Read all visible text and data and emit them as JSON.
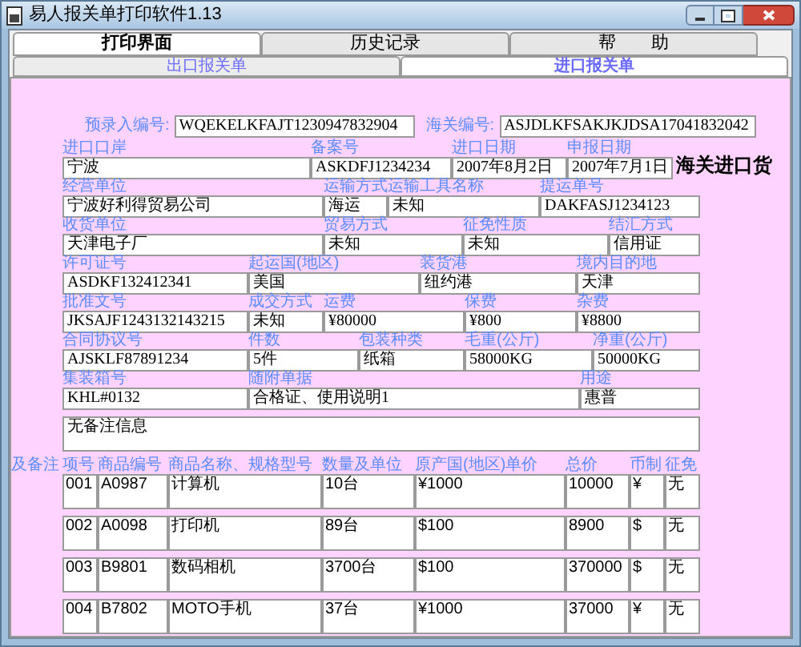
{
  "window": {
    "title": "易人报关单打印软件1.13"
  },
  "tabs": [
    {
      "label": "打印界面",
      "selected": true
    },
    {
      "label": "历史记录",
      "selected": false
    },
    {
      "label": "帮　　助",
      "selected": false
    }
  ],
  "subtabs": [
    {
      "label": "出口报关单",
      "selected": false
    },
    {
      "label": "进口报关单",
      "selected": true
    }
  ],
  "form": {
    "preentry_no": {
      "label": "预录入编号:",
      "value": "WQEKELKFAJT1230947832904"
    },
    "customs_no": {
      "label": "海关编号:",
      "value": "ASJDLKFSAKJKJDSA17041832042"
    },
    "title": "海关进口货",
    "field_lines": [
      [
        {
          "label": "进口口岸",
          "value": "宁波"
        },
        {
          "label": "备案号",
          "value": "ASKDFJ1234234"
        },
        {
          "label": "进口日期",
          "value": "2007年8月2日"
        },
        {
          "label": "申报日期",
          "value": "2007年7月1日"
        }
      ],
      [
        {
          "label": "经营单位",
          "value": "宁波好利得贸易公司"
        },
        {
          "label": "运输方式",
          "value": "海运"
        },
        {
          "label": "运输工具名称",
          "value": "未知"
        },
        {
          "label": "提运单号",
          "value": "DAKFASJ1234123"
        }
      ],
      [
        {
          "label": "收货单位",
          "value": "天津电子厂"
        },
        {
          "label": "贸易方式",
          "value": "未知"
        },
        {
          "label": "征免性质",
          "value": "未知"
        },
        {
          "label": "结汇方式",
          "value": "信用证"
        }
      ],
      [
        {
          "label": "许可证号",
          "value": "ASDKF132412341"
        },
        {
          "label": "起运国(地区)",
          "value": "美国"
        },
        {
          "label": "装货港",
          "value": "纽约港"
        },
        {
          "label": "境内目的地",
          "value": "天津"
        }
      ],
      [
        {
          "label": "批准文号",
          "value": "JKSAJF1243132143215"
        },
        {
          "label": "成交方式",
          "value": "未知"
        },
        {
          "label": "运费",
          "value": "¥80000"
        },
        {
          "label": "保费",
          "value": "¥800"
        },
        {
          "label": "杂费",
          "value": "¥8800"
        }
      ],
      [
        {
          "label": "合同协议号",
          "value": "AJSKLF87891234"
        },
        {
          "label": "件数",
          "value": "5件"
        },
        {
          "label": "包装种类",
          "value": "纸箱"
        },
        {
          "label": "毛重(公斤)",
          "value": "58000KG"
        },
        {
          "label": "净重(公斤)",
          "value": "50000KG"
        }
      ],
      [
        {
          "label": "集装箱号",
          "value": "KHL#0132"
        },
        {
          "label": "随附单据",
          "value": "合格证、使用说明1"
        },
        {
          "label": "用途",
          "value": "惠普"
        }
      ]
    ],
    "remarks": {
      "label": "及备注",
      "value": "无备注信息"
    }
  },
  "items": {
    "columns": [
      "项号",
      "商品编号",
      "商品名称、规格型号",
      "数量及单位",
      "原产国(地区)单价",
      "总价",
      "币制",
      "征免"
    ],
    "rows": [
      [
        "001",
        "A0987",
        "计算机",
        "10台",
        "¥1000",
        "10000",
        "¥",
        "无"
      ],
      [
        "002",
        "A0098",
        "打印机",
        "89台",
        "$100",
        "8900",
        "$",
        "无"
      ],
      [
        "003",
        "B9801",
        "数码相机",
        "3700台",
        "$100",
        "370000",
        "$",
        "无"
      ],
      [
        "004",
        "B7802",
        "MOTO手机",
        "37台",
        "¥1000",
        "37000",
        "¥",
        "无"
      ]
    ]
  }
}
